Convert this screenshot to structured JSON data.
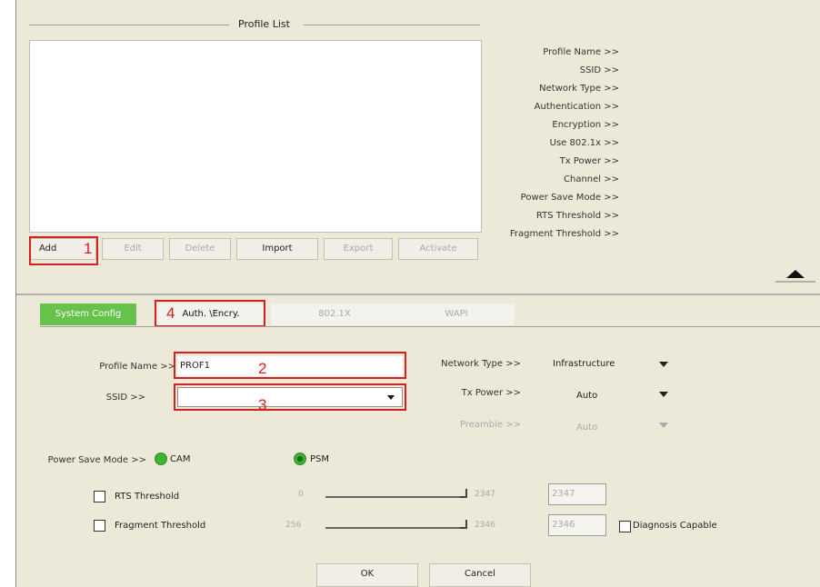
{
  "profile_list": {
    "title": "Profile List",
    "info_labels": [
      "Profile Name >>",
      "SSID >>",
      "Network Type >>",
      "Authentication >>",
      "Encryption >>",
      "Use 802.1x >>",
      "Tx Power >>",
      "Channel >>",
      "Power Save Mode >>",
      "RTS Threshold >>",
      "Fragment Threshold >>"
    ],
    "buttons": {
      "add": "Add",
      "edit": "Edit",
      "delete": "Delete",
      "import": "Import",
      "export": "Export",
      "activate": "Activate"
    }
  },
  "tabs": {
    "system_config": "System Config",
    "auth_encry": "Auth. \\Encry.",
    "dot1x": "802.1X",
    "wapi": "WAPI"
  },
  "form": {
    "profile_name_label": "Profile Name >>",
    "profile_name_value": "PROF1",
    "ssid_label": "SSID >>",
    "ssid_value": "",
    "network_type_label": "Network Type >>",
    "network_type_value": "Infrastructure",
    "tx_power_label": "Tx Power >>",
    "tx_power_value": "Auto",
    "preamble_label": "Preamble >>",
    "preamble_value": "Auto",
    "power_save_label": "Power Save Mode >>",
    "power_save_options": [
      "CAM",
      "PSM"
    ],
    "rts_label": "RTS Threshold",
    "rts_min": "0",
    "rts_max": "2347",
    "rts_value": "2347",
    "frag_label": "Fragment Threshold",
    "frag_min": "256",
    "frag_max": "2346",
    "frag_value": "2346",
    "diagnosis_label": "Diagnosis Capable"
  },
  "annotations": [
    "1",
    "2",
    "3",
    "4"
  ],
  "actions": {
    "ok": "OK",
    "cancel": "Cancel"
  },
  "colors": {
    "highlight": "#d42020",
    "active_tab": "#66c24a",
    "radio": "#3bb531"
  }
}
